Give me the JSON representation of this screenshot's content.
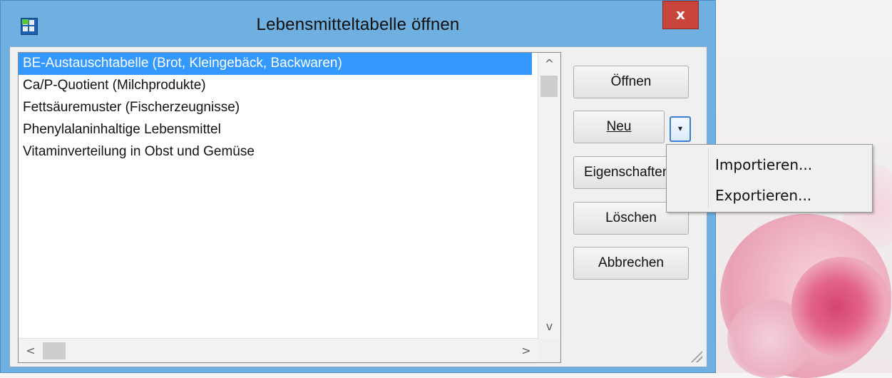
{
  "dialog": {
    "title": "Lebensmitteltabelle öffnen",
    "close_label": "x"
  },
  "list": {
    "items": [
      {
        "label": "BE-Austauschtabelle (Brot, Kleingebäck, Backwaren)",
        "selected": true
      },
      {
        "label": "Ca/P-Quotient (Milchprodukte)",
        "selected": false
      },
      {
        "label": "Fettsäuremuster (Fischerzeugnisse)",
        "selected": false
      },
      {
        "label": "Phenylalaninhaltige Lebensmittel",
        "selected": false
      },
      {
        "label": "Vitaminverteilung in Obst und Gemüse",
        "selected": false
      }
    ],
    "scroll_up": "^",
    "scroll_down": "v",
    "scroll_left": "<",
    "scroll_right": ">"
  },
  "buttons": {
    "open": "Öffnen",
    "new": "Neu",
    "dropdown": "▾",
    "properties": "Eigenschaften",
    "delete": "Löschen",
    "cancel": "Abbrechen"
  },
  "menu": {
    "items": [
      "Importieren...",
      "Exportieren..."
    ]
  },
  "colors": {
    "selection": "#3399ff",
    "close_button": "#c9453b",
    "window_frame": "#6fb0e0"
  },
  "icons": {
    "app": "table-grid-icon",
    "close": "close-icon",
    "dropdown": "chevron-down-icon",
    "grip": "resize-grip-icon"
  }
}
